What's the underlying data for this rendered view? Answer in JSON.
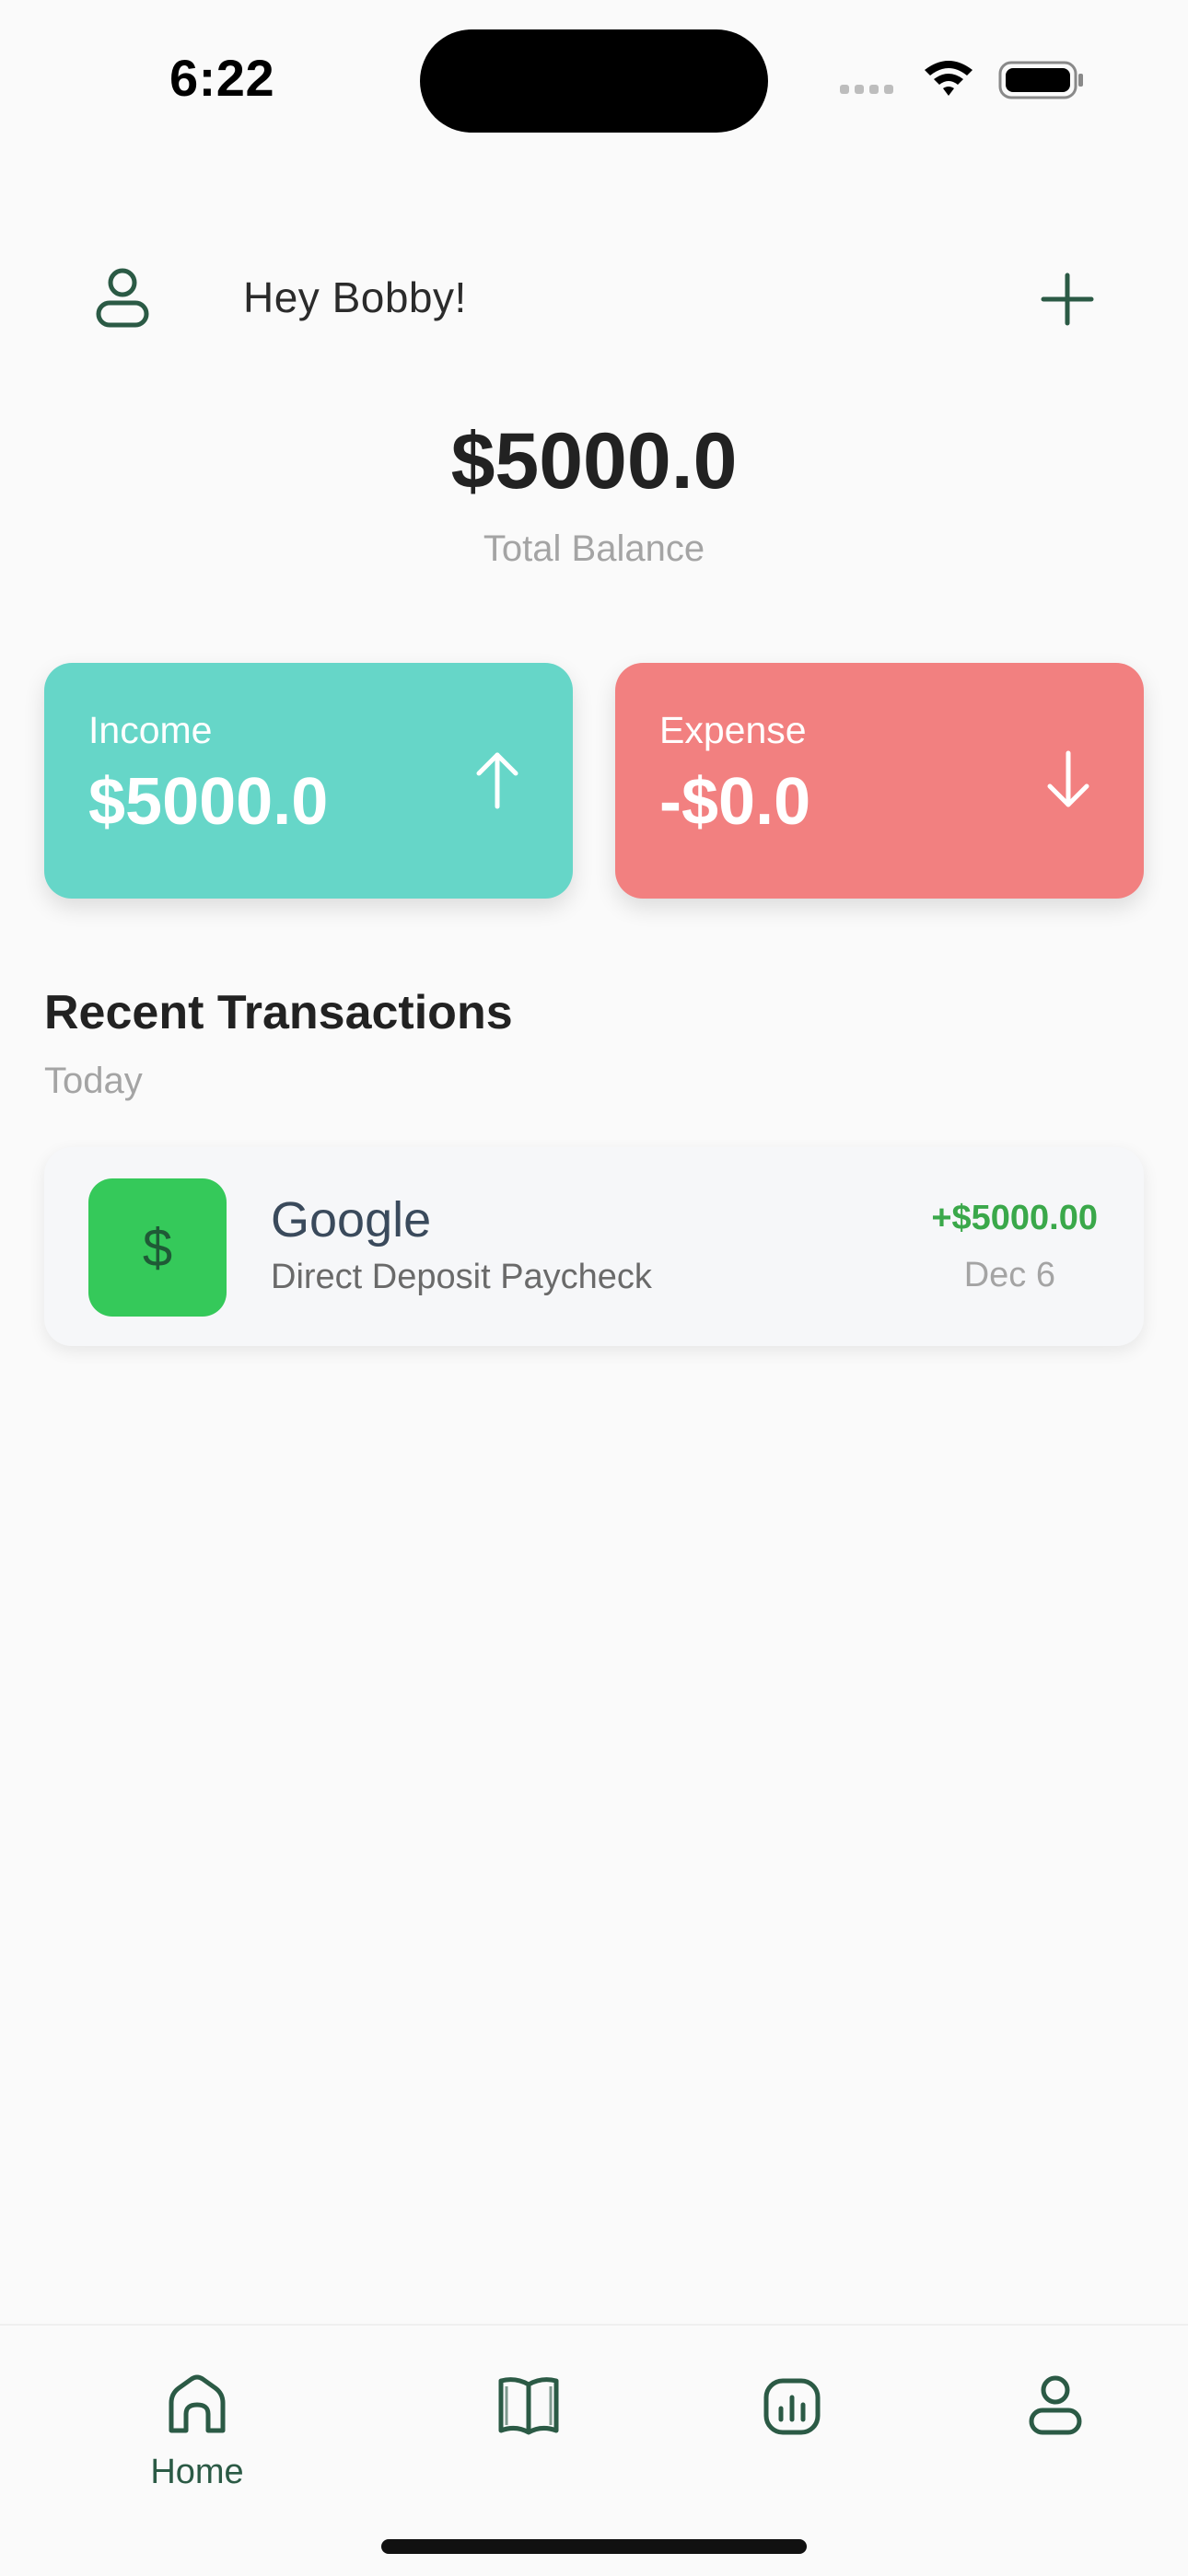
{
  "status_bar": {
    "time": "6:22"
  },
  "header": {
    "greeting": "Hey Bobby!",
    "profile_icon": "person-icon",
    "add_icon": "plus-icon"
  },
  "balance": {
    "amount": "$5000.0",
    "label": "Total Balance"
  },
  "cards": {
    "income": {
      "label": "Income",
      "value": "$5000.0",
      "icon": "arrow-up-icon",
      "color": "#66d6c8"
    },
    "expense": {
      "label": "Expense",
      "value": "-$0.0",
      "icon": "arrow-down-icon",
      "color": "#f28080"
    }
  },
  "recent": {
    "title": "Recent Transactions",
    "group_label": "Today",
    "transactions": [
      {
        "icon_symbol": "$",
        "name": "Google",
        "description": "Direct Deposit Paycheck",
        "amount": "+$5000.00",
        "date": "Dec 6",
        "amount_color": "#3aa84a"
      }
    ]
  },
  "bottom_nav": {
    "items": [
      {
        "label": "Home",
        "icon": "home-icon",
        "active": true
      },
      {
        "label": "",
        "icon": "book-icon",
        "active": false
      },
      {
        "label": "",
        "icon": "chart-icon",
        "active": false
      },
      {
        "label": "",
        "icon": "person-icon",
        "active": false
      }
    ]
  },
  "colors": {
    "accent": "#2b5a45",
    "background": "#fafafa"
  }
}
